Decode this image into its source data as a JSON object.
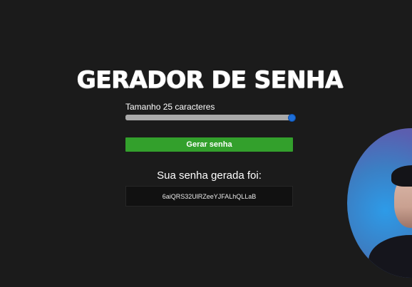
{
  "app": {
    "title": "GERADOR DE SENHA"
  },
  "length_control": {
    "label": "Tamanho 25 caracteres",
    "value": 25,
    "fraction": 1.0
  },
  "generate_button": {
    "label": "Gerar senha"
  },
  "result": {
    "label": "Sua senha gerada foi:",
    "password": "6aiQRS32UlRZeeYJFALhQLLaB"
  },
  "colors": {
    "background": "#1b1b1b",
    "button": "#33a02c",
    "slider_track": "#a9a9a9",
    "slider_thumb": "#1e6fd9",
    "password_box": "#111111"
  },
  "icons": {
    "webcam_overlay": "webcam-presenter"
  }
}
